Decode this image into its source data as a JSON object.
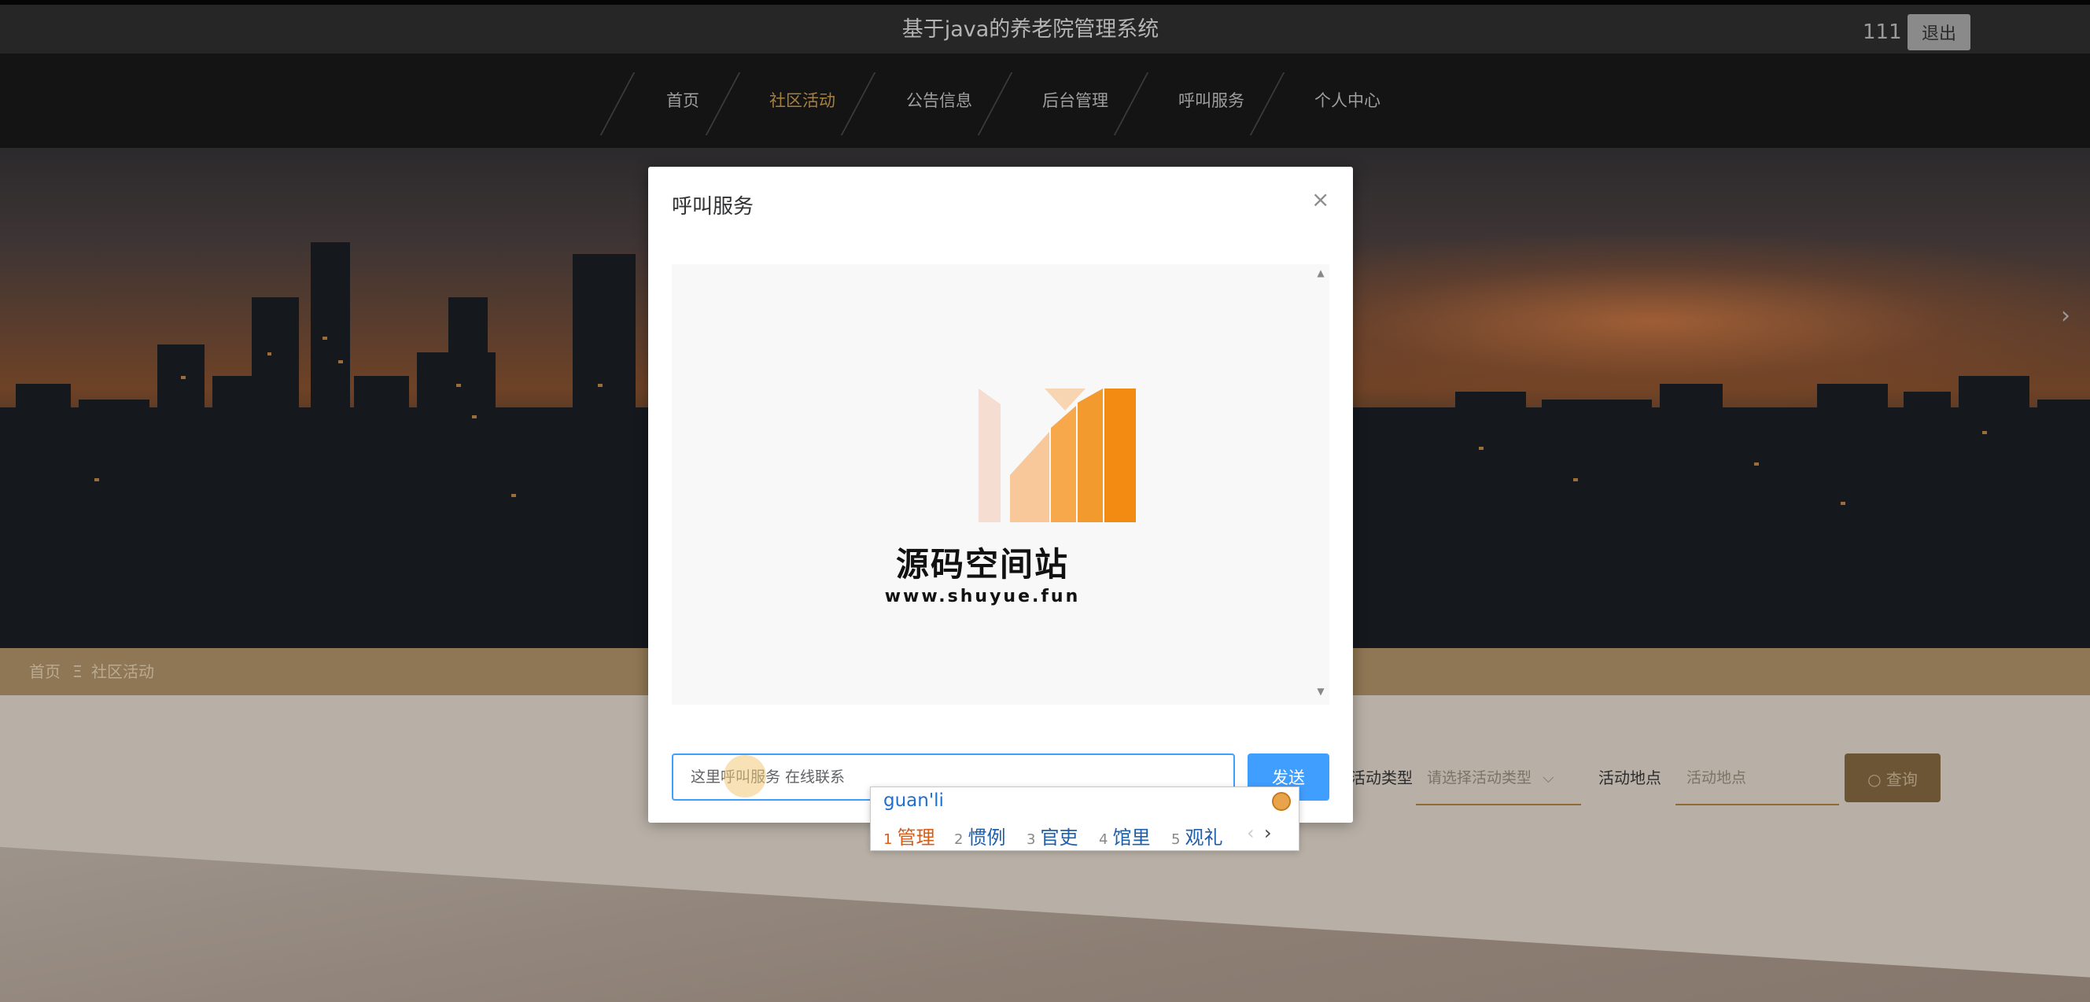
{
  "header": {
    "site_title": "基于java的养老院管理系统",
    "user_name": "111",
    "logout_label": "退出"
  },
  "nav": {
    "items": [
      {
        "label": "首页",
        "active": false
      },
      {
        "label": "社区活动",
        "active": true
      },
      {
        "label": "公告信息",
        "active": false
      },
      {
        "label": "后台管理",
        "active": false
      },
      {
        "label": "呼叫服务",
        "active": false
      },
      {
        "label": "个人中心",
        "active": false
      }
    ]
  },
  "banner": {
    "next_icon": "chevron-right-icon",
    "next_glyph": "›"
  },
  "breadcrumb": {
    "home": "首页",
    "separator": "Ξ",
    "current": "社区活动"
  },
  "search": {
    "type_label": "活动类型",
    "type_placeholder": "请选择活动类型",
    "place_label": "活动地点",
    "place_placeholder": "活动地点",
    "button_label": "查询",
    "button_icon": "search-icon"
  },
  "modal": {
    "title": "呼叫服务",
    "close_glyph": "×",
    "chat_logo_name": "源码空间站",
    "chat_logo_url": "www.shuyue.fun",
    "input_text": "这里呼叫服务 在线联系",
    "send_label": "发送"
  },
  "ime": {
    "pinyin": "guan'li",
    "candidates": [
      {
        "num": "1",
        "text": "管理"
      },
      {
        "num": "2",
        "text": "惯例"
      },
      {
        "num": "3",
        "text": "官吏"
      },
      {
        "num": "4",
        "text": "馆里"
      },
      {
        "num": "5",
        "text": "观礼"
      }
    ],
    "prev_glyph": "‹",
    "next_glyph": "›"
  },
  "colors": {
    "accent_gold": "#a5803e",
    "send_blue": "#409eff",
    "logo_orange": "#f39120"
  }
}
